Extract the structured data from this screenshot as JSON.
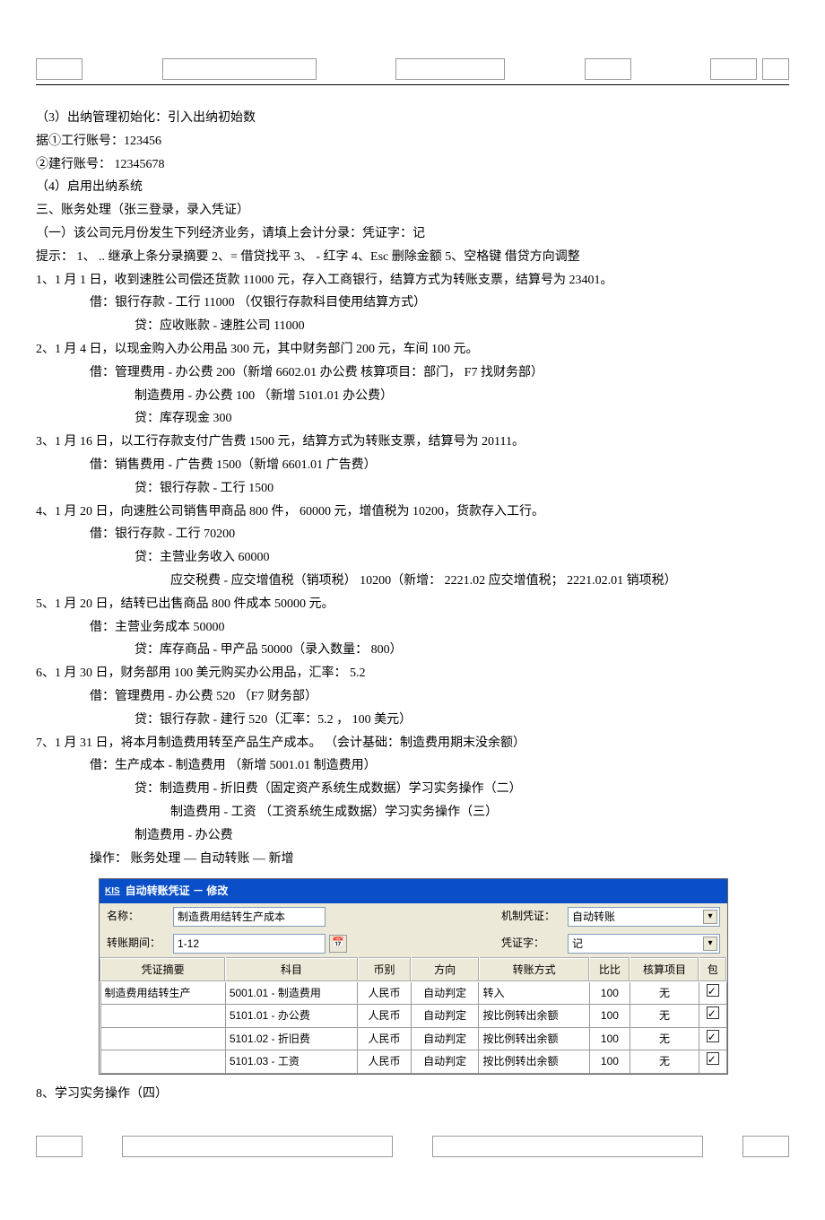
{
  "lines": {
    "l1": "（3）出纳管理初始化：引入出纳初始数",
    "l2": "据①工行账号：123456",
    "l3": "②建行账号： 12345678",
    "l4": "（4）启用出纳系统",
    "l5": "三、账务处理（张三登录，录入凭证）",
    "l6": "（一）该公司元月份发生下列经济业务，请填上会计分录：凭证字：记",
    "l7": "提示： 1、 .. 继承上条分录摘要    2、= 借贷找平 3、 - 红字 4、Esc 删除金额    5、空格键   借贷方向调整",
    "l8": "1、1 月 1 日，收到速胜公司偿还货款    11000 元，存入工商银行，结算方式为转账支票，结算号为      23401。",
    "l9": "借：银行存款 - 工行 11000  （仅银行存款科目使用结算方式）",
    "l10": "贷：应收账款 - 速胜公司 11000",
    "l11": "2、1 月 4 日，以现金购入办公用品    300 元，其中财务部门  200 元，车间 100 元。",
    "l12": "借：管理费用 - 办公费   200（新增 6602.01 办公费  核算项目：部门，   F7 找财务部）",
    "l13": "制造费用 - 办公费 100  （新增 5101.01 办公费）",
    "l14": "贷：库存现金   300",
    "l15": "3、1 月 16 日，以工行存款支付广告费    1500 元，结算方式为转账支票，结算号为     20111。",
    "l16": "借：销售费用 - 广告费   1500（新增 6601.01 广告费）",
    "l17": "贷：银行存款 - 工行 1500",
    "l18": "4、1 月 20 日，向速胜公司销售甲商品    800 件， 60000 元，增值税为  10200，货款存入工行。",
    "l19": "借：银行存款 - 工行 70200",
    "l20": "贷：主营业务收入    60000",
    "l21": "应交税费 - 应交增值税（销项税）     10200（新增： 2221.02 应交增值税；    2221.02.01 销项税）",
    "l22": "5、1 月 20 日，结转已出售商品   800 件成本 50000 元。",
    "l23": "借：主营业务成本    50000",
    "l24": "贷：库存商品 - 甲产品   50000（录入数量： 800）",
    "l25": "6、1 月 30 日，财务部用 100  美元购买办公用品，汇率：    5.2",
    "l26": "借：管理费用 - 办公费 520  （F7 财务部）",
    "l27": "贷：银行存款 - 建行 520（汇率：5.2   ， 100 美元）",
    "l28": "7、1 月 31 日，将本月制造费用转至产品生产成本。  （会计基础：制造费用期末没余额）",
    "l29": "借：生产成本 - 制造费用       （新增 5001.01 制造费用）",
    "l30": "贷：制造费用 - 折旧费（固定资产系统生成数据）学习实务操作（二）",
    "l31": "制造费用 - 工资 （工资系统生成数据）学习实务操作（三）",
    "l32": "制造费用 - 办公费",
    "l33": "操作： 账务处理 — 自动转账 — 新增",
    "l34": "8、学习实务操作（四）"
  },
  "dialog": {
    "title": "自动转账凭证 － 修改",
    "kis": "KIS",
    "name_label": "名称：",
    "name_value": "制造费用结转生产成本",
    "period_label": "转账期间：",
    "period_value": "1-12",
    "mech_label": "机制凭证：",
    "mech_value": "自动转账",
    "word_label": "凭证字：",
    "word_value": "记",
    "headers": {
      "summary": "凭证摘要",
      "subject": "科目",
      "currency": "币别",
      "direction": "方向",
      "method": "转账方式",
      "ratio": "比比",
      "item": "核算项目",
      "incl": "包"
    },
    "rows": [
      {
        "summary": "制造费用结转生产",
        "subject": "5001.01 - 制造费用",
        "currency": "人民币",
        "direction": "自动判定",
        "method": "转入",
        "ratio": "100",
        "item": "无",
        "incl": true
      },
      {
        "summary": "",
        "subject": "5101.01 - 办公费",
        "currency": "人民币",
        "direction": "自动判定",
        "method": "按比例转出余额",
        "ratio": "100",
        "item": "无",
        "incl": true
      },
      {
        "summary": "",
        "subject": "5101.02 - 折旧费",
        "currency": "人民币",
        "direction": "自动判定",
        "method": "按比例转出余额",
        "ratio": "100",
        "item": "无",
        "incl": true
      },
      {
        "summary": "",
        "subject": "5101.03 - 工资",
        "currency": "人民币",
        "direction": "自动判定",
        "method": "按比例转出余额",
        "ratio": "100",
        "item": "无",
        "incl": true
      }
    ]
  }
}
